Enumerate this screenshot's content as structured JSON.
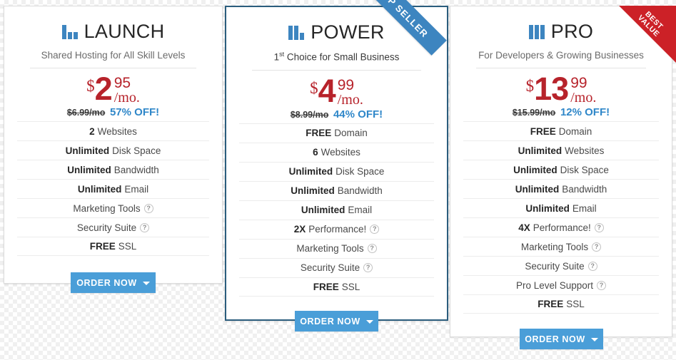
{
  "theme": {
    "accent_blue": "#3d85c0",
    "button_blue": "#4a9ed8",
    "price_red": "#b7232b",
    "ribbon_red": "#cc2127",
    "highlight_border": "#2b5d7d",
    "discount_blue": "#2f87c9"
  },
  "ribbons": {
    "top_seller": "TOP SELLER",
    "best_value_line1": "BEST",
    "best_value_line2": "VALUE"
  },
  "order_button": {
    "label": "ORDER NOW",
    "caret_icon": "chevron-down-icon"
  },
  "help_glyph": "?",
  "plans": [
    {
      "id": "launch",
      "name": "LAUNCH",
      "icon": "bar-chart-icon-1",
      "tagline": "Shared Hosting for All Skill Levels",
      "tagline_prefix": "",
      "tagline_sup": "",
      "currency": "$",
      "dollars": "2",
      "cents": "95",
      "per": "/mo.",
      "old_price": "$6.99/mo",
      "discount": "57% OFF!",
      "features": [
        {
          "strong": "2",
          "text": "Websites",
          "help": false
        },
        {
          "strong": "Unlimited",
          "text": "Disk Space",
          "help": false
        },
        {
          "strong": "Unlimited",
          "text": "Bandwidth",
          "help": false
        },
        {
          "strong": "Unlimited",
          "text": "Email",
          "help": false
        },
        {
          "strong": "",
          "text": "Marketing Tools",
          "help": true
        },
        {
          "strong": "",
          "text": "Security Suite",
          "help": true
        },
        {
          "strong": "FREE",
          "text": "SSL",
          "help": false
        }
      ]
    },
    {
      "id": "power",
      "name": "POWER",
      "icon": "bar-chart-icon-2",
      "tagline": " Choice for Small Business",
      "tagline_prefix": "1",
      "tagline_sup": "st",
      "currency": "$",
      "dollars": "4",
      "cents": "99",
      "per": "/mo.",
      "old_price": "$8.99/mo",
      "discount": "44% OFF!",
      "features": [
        {
          "strong": "FREE",
          "text": "Domain",
          "help": false
        },
        {
          "strong": "6",
          "text": "Websites",
          "help": false
        },
        {
          "strong": "Unlimited",
          "text": "Disk Space",
          "help": false
        },
        {
          "strong": "Unlimited",
          "text": "Bandwidth",
          "help": false
        },
        {
          "strong": "Unlimited",
          "text": "Email",
          "help": false
        },
        {
          "strong": "2X",
          "text": "Performance!",
          "help": true
        },
        {
          "strong": "",
          "text": "Marketing Tools",
          "help": true
        },
        {
          "strong": "",
          "text": "Security Suite",
          "help": true
        },
        {
          "strong": "FREE",
          "text": "SSL",
          "help": false
        }
      ]
    },
    {
      "id": "pro",
      "name": "PRO",
      "icon": "bar-chart-icon-3",
      "tagline": "For Developers & Growing Businesses",
      "tagline_prefix": "",
      "tagline_sup": "",
      "currency": "$",
      "dollars": "13",
      "cents": "99",
      "per": "/mo.",
      "old_price": "$15.99/mo",
      "discount": "12% OFF!",
      "features": [
        {
          "strong": "FREE",
          "text": "Domain",
          "help": false
        },
        {
          "strong": "Unlimited",
          "text": "Websites",
          "help": false
        },
        {
          "strong": "Unlimited",
          "text": "Disk Space",
          "help": false
        },
        {
          "strong": "Unlimited",
          "text": "Bandwidth",
          "help": false
        },
        {
          "strong": "Unlimited",
          "text": "Email",
          "help": false
        },
        {
          "strong": "4X",
          "text": "Performance!",
          "help": true
        },
        {
          "strong": "",
          "text": "Marketing Tools",
          "help": true
        },
        {
          "strong": "",
          "text": "Security Suite",
          "help": true
        },
        {
          "strong": "",
          "text": "Pro Level Support",
          "help": true
        },
        {
          "strong": "FREE",
          "text": "SSL",
          "help": false
        }
      ]
    }
  ]
}
